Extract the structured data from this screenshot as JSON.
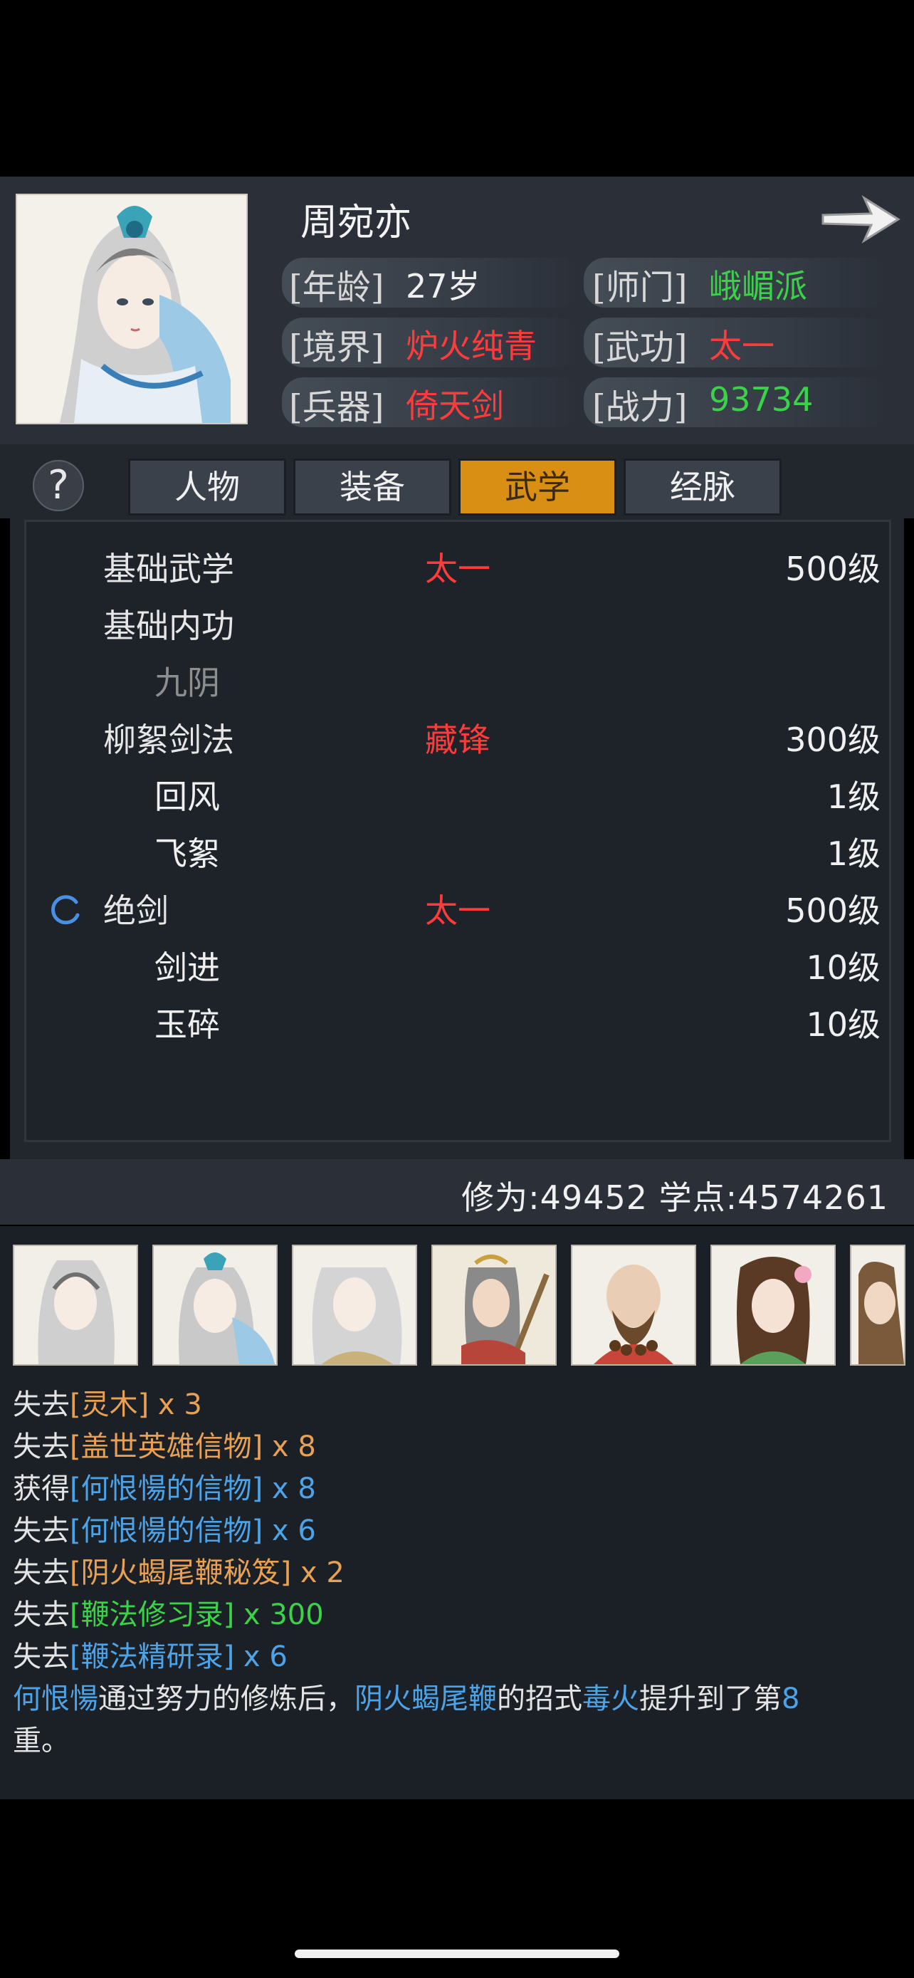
{
  "character": {
    "name": "周宛亦",
    "age_label": "[年龄]",
    "age": "27岁",
    "sect_label": "[师门]",
    "sect": "峨嵋派",
    "realm_label": "[境界]",
    "realm": "炉火纯青",
    "martial_label": "[武功]",
    "martial": "太一",
    "weapon_label": "[兵器]",
    "weapon": "倚天剑",
    "power_label": "[战力]",
    "power": "93734"
  },
  "help_symbol": "?",
  "tabs": [
    {
      "label": "人物",
      "active": false
    },
    {
      "label": "装备",
      "active": false
    },
    {
      "label": "武学",
      "active": true
    },
    {
      "label": "经脉",
      "active": false
    }
  ],
  "skills": [
    {
      "name": "基础武学",
      "style": "太一",
      "level": "500级"
    },
    {
      "name": "基础内功",
      "style": "",
      "level": ""
    },
    {
      "name": "九阴",
      "style": "",
      "level": ""
    },
    {
      "name": "柳絮剑法",
      "style": "藏锋",
      "level": "300级"
    },
    {
      "name": "回风",
      "style": "",
      "level": "1级"
    },
    {
      "name": "飞絮",
      "style": "",
      "level": "1级"
    },
    {
      "name": "绝剑",
      "style": "太一",
      "level": "500级"
    },
    {
      "name": "剑进",
      "style": "",
      "level": "10级"
    },
    {
      "name": "玉碎",
      "style": "",
      "level": "10级"
    }
  ],
  "stats": {
    "text": "修为:49452  学点:4574261"
  },
  "log": [
    {
      "verb": "失去",
      "item": "[灵木]",
      "count": " x 3",
      "color": "orange"
    },
    {
      "verb": "失去",
      "item": "[盖世英雄信物]",
      "count": " x 8",
      "color": "orange"
    },
    {
      "verb": "获得",
      "item": "[何恨愓的信物]",
      "count": " x 8",
      "color": "blue"
    },
    {
      "verb": "失去",
      "item": "[何恨愓的信物]",
      "count": " x 6",
      "color": "blue"
    },
    {
      "verb": "失去",
      "item": "[阴火蝎尾鞭秘笈]",
      "count": " x 2",
      "color": "orange"
    },
    {
      "verb": "失去",
      "item": "[鞭法修习录]",
      "count": " x 300",
      "color": "green"
    },
    {
      "verb": "失去",
      "item": "[鞭法精研录]",
      "count": " x 6",
      "color": "blue"
    }
  ],
  "log_message": {
    "p1": "何恨愓",
    "p2": "通过努力的修炼后，",
    "p3": "阴火蝎尾鞭",
    "p4": "的招式",
    "p5": "毒火",
    "p6": "提升到了第",
    "p7": "8",
    "p8": "重。"
  }
}
